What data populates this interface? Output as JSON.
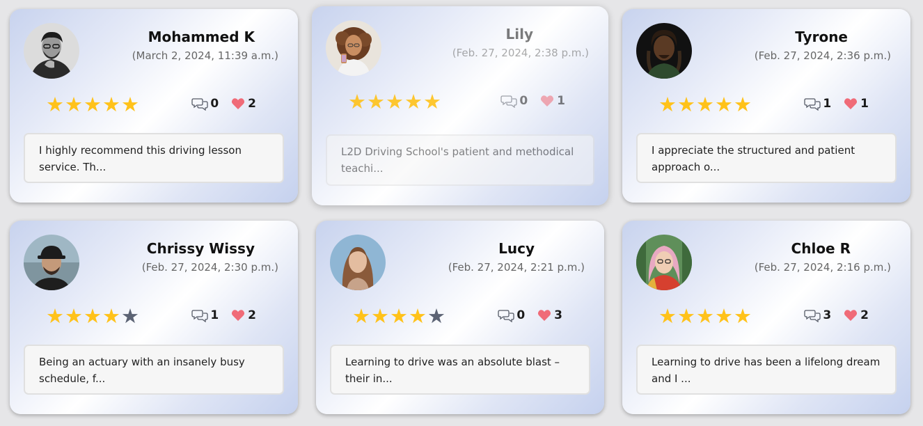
{
  "reviews": [
    {
      "name": "Mohammed K",
      "date": "(March 2, 2024, 11:39 a.m.)",
      "rating": 5,
      "comments": "0",
      "likes": "2",
      "excerpt": "I highly recommend this driving lesson service. Th...",
      "avatar": "man-glasses-photo"
    },
    {
      "name": "Lily",
      "date": "(Feb. 27, 2024, 2:38 p.m.)",
      "rating": 5,
      "comments": "0",
      "likes": "1",
      "excerpt": "L2D Driving School's patient and methodical teachi...",
      "avatar": "woman-curly-hair-photo"
    },
    {
      "name": "Tyrone",
      "date": "(Feb. 27, 2024, 2:36 p.m.)",
      "rating": 5,
      "comments": "1",
      "likes": "1",
      "excerpt": "I appreciate the structured and patient approach o...",
      "avatar": "man-dreadlocks-photo"
    },
    {
      "name": "Chrissy Wissy",
      "date": "(Feb. 27, 2024, 2:30 p.m.)",
      "rating": 4,
      "comments": "1",
      "likes": "2",
      "excerpt": "Being an actuary with an insanely busy schedule, f...",
      "avatar": "man-cap-photo"
    },
    {
      "name": "Lucy",
      "date": "(Feb. 27, 2024, 2:21 p.m.)",
      "rating": 4,
      "comments": "0",
      "likes": "3",
      "excerpt": "Learning to drive was an absolute blast – their in...",
      "avatar": "woman-long-hair-photo"
    },
    {
      "name": "Chloe R",
      "date": "(Feb. 27, 2024, 2:16 p.m.)",
      "rating": 5,
      "comments": "3",
      "likes": "2",
      "excerpt": "Learning to drive has been a lifelong dream and I ...",
      "avatar": "woman-pink-hair-photo"
    }
  ],
  "colors": {
    "star_on": "#ffc21a",
    "star_off": "#5c6374",
    "heart": "#f06b78",
    "comment_icon": "#555a66"
  }
}
